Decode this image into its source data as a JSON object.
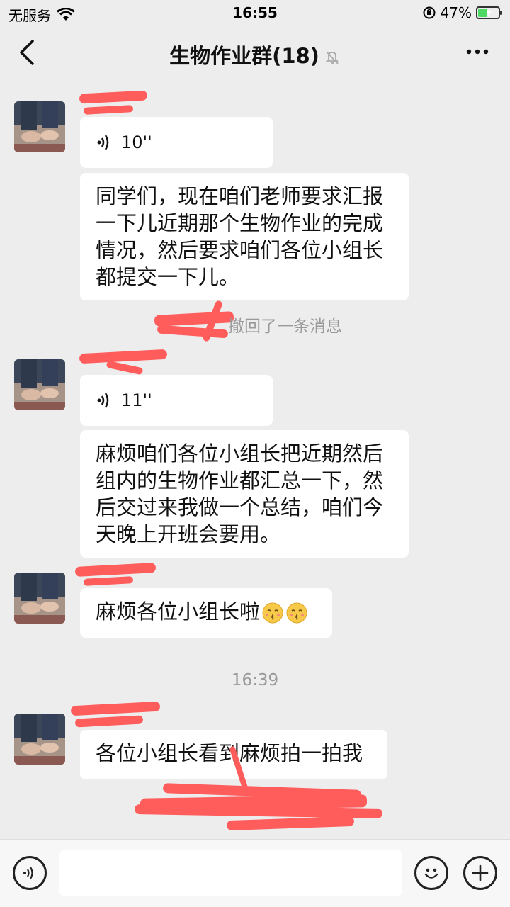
{
  "status_bar": {
    "carrier": "无服务",
    "time": "16:55",
    "battery": "47%",
    "battery_level": 0.47
  },
  "nav": {
    "title": "生物作业群(18)",
    "icons": [
      "back-arrow-icon",
      "mute-bell-icon",
      "more-dots-icon"
    ]
  },
  "messages": [
    {
      "type": "voice",
      "duration": "10''"
    },
    {
      "type": "text",
      "lines": [
        "同学们，现在咱们老师要求汇报",
        "一下儿近期那个生物作业的完成",
        "情况，然后要求咱们各位小组长",
        "都提交一下儿。"
      ]
    },
    {
      "type": "system",
      "text": "撤回了一条消息"
    },
    {
      "type": "voice",
      "duration": "11''"
    },
    {
      "type": "text",
      "lines": [
        "麻烦咱们各位小组长把近期然后",
        "组内的生物作业都汇总一下，然",
        "后交过来我做一个总结，咱们今",
        "天晚上开班会要用。"
      ]
    },
    {
      "type": "text",
      "text": "麻烦各位小组长啦",
      "emojis": [
        "kissing-face-icon",
        "kissing-face-icon"
      ]
    },
    {
      "type": "timestamp",
      "text": "16:39"
    },
    {
      "type": "text",
      "text": "各位小组长看到麻烦拍一拍我"
    }
  ],
  "input_bar": {
    "icons": [
      "voice-icon",
      "emoji-icon",
      "plus-icon"
    ],
    "placeholder": ""
  },
  "colors": {
    "background": "#ededed",
    "bubble": "#ffffff",
    "redaction": "#ff5c5c",
    "battery": "#4cd964"
  }
}
